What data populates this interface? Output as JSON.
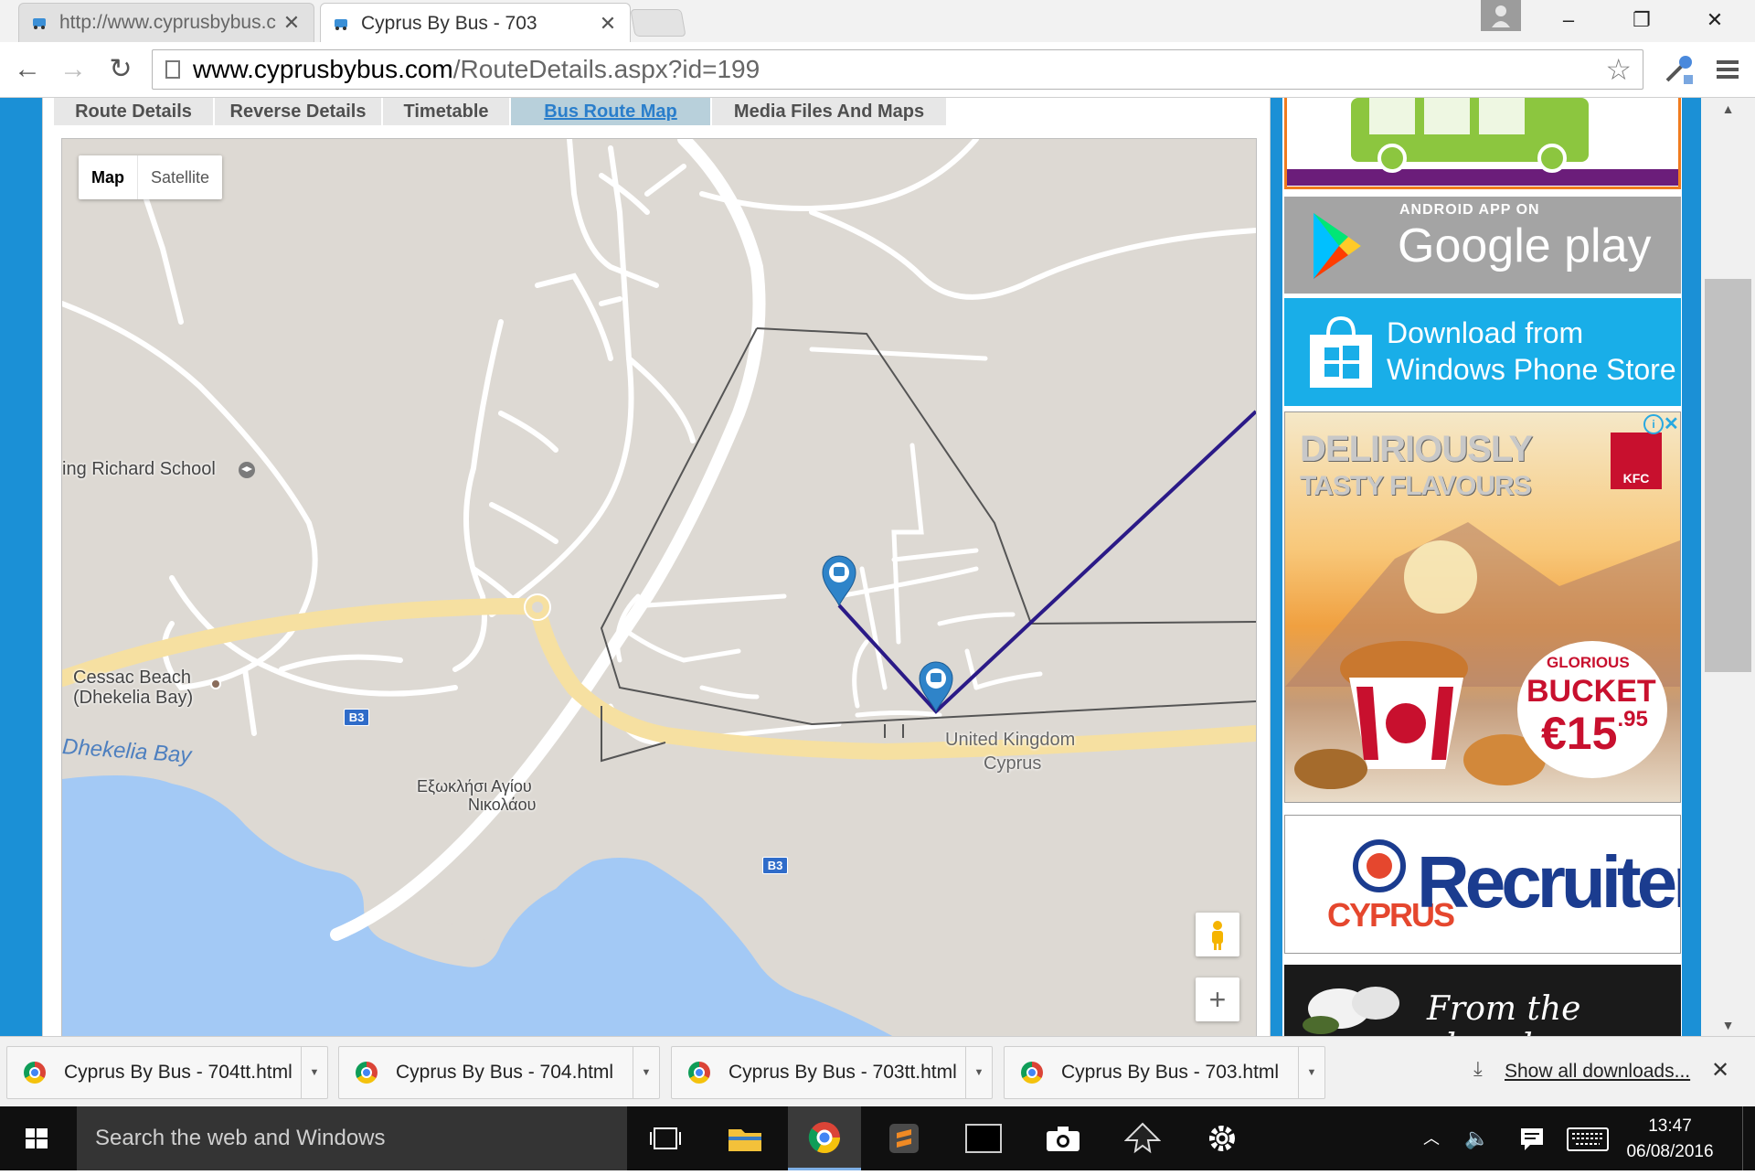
{
  "browser": {
    "tabs": [
      {
        "title": "http://www.cyprusbybus.c",
        "active": false
      },
      {
        "title": "Cyprus By Bus - 703",
        "active": true
      }
    ],
    "url_host": "www.cyprusbybus.com",
    "url_path": "/RouteDetails.aspx?id=199"
  },
  "page": {
    "tabs": [
      "Route Details",
      "Reverse Details",
      "Timetable",
      "Bus Route Map",
      "Media Files And Maps"
    ],
    "active_tab": "Bus Route Map",
    "map": {
      "type_buttons": {
        "map": "Map",
        "satellite": "Satellite"
      },
      "labels": {
        "school": "ing Richard School",
        "beach_line1": "Cessac Beach",
        "beach_line2": "(Dhekelia Bay)",
        "bay": "Dhekelia Bay",
        "church_line1": "Εξωκλήσι Αγίου",
        "church_line2": "Νικολάου",
        "country_line1": "United Kingdom",
        "country_line2": "Cyprus",
        "road_b3": "B3"
      },
      "zoom_in": "+",
      "route_color": "#2b1a87"
    }
  },
  "sidebar_ads": {
    "google_play_top": "ANDROID APP ON",
    "google_play_main": "Google play",
    "windows_line1": "Download from",
    "windows_line2": "Windows Phone Store",
    "kfc_headline1": "DELIRIOUSLY",
    "kfc_headline2": "TASTY FLAVOURS",
    "kfc_brand": "KFC",
    "kfc_glorious": "GLORIOUS",
    "kfc_bucket": "BUCKET",
    "kfc_price": "€15",
    "kfc_price_cents": ".95",
    "recruiter_cyprus": "CYPRUS",
    "recruiter_word": "Recruiter",
    "church_text": "From the church"
  },
  "downloads": {
    "items": [
      "Cyprus By Bus - 704tt.html",
      "Cyprus By Bus - 704.html",
      "Cyprus By Bus - 703tt.html",
      "Cyprus By Bus - 703.html"
    ],
    "show_all": "Show all downloads..."
  },
  "taskbar": {
    "search_placeholder": "Search the web and Windows",
    "time": "13:47",
    "date": "06/08/2016"
  }
}
